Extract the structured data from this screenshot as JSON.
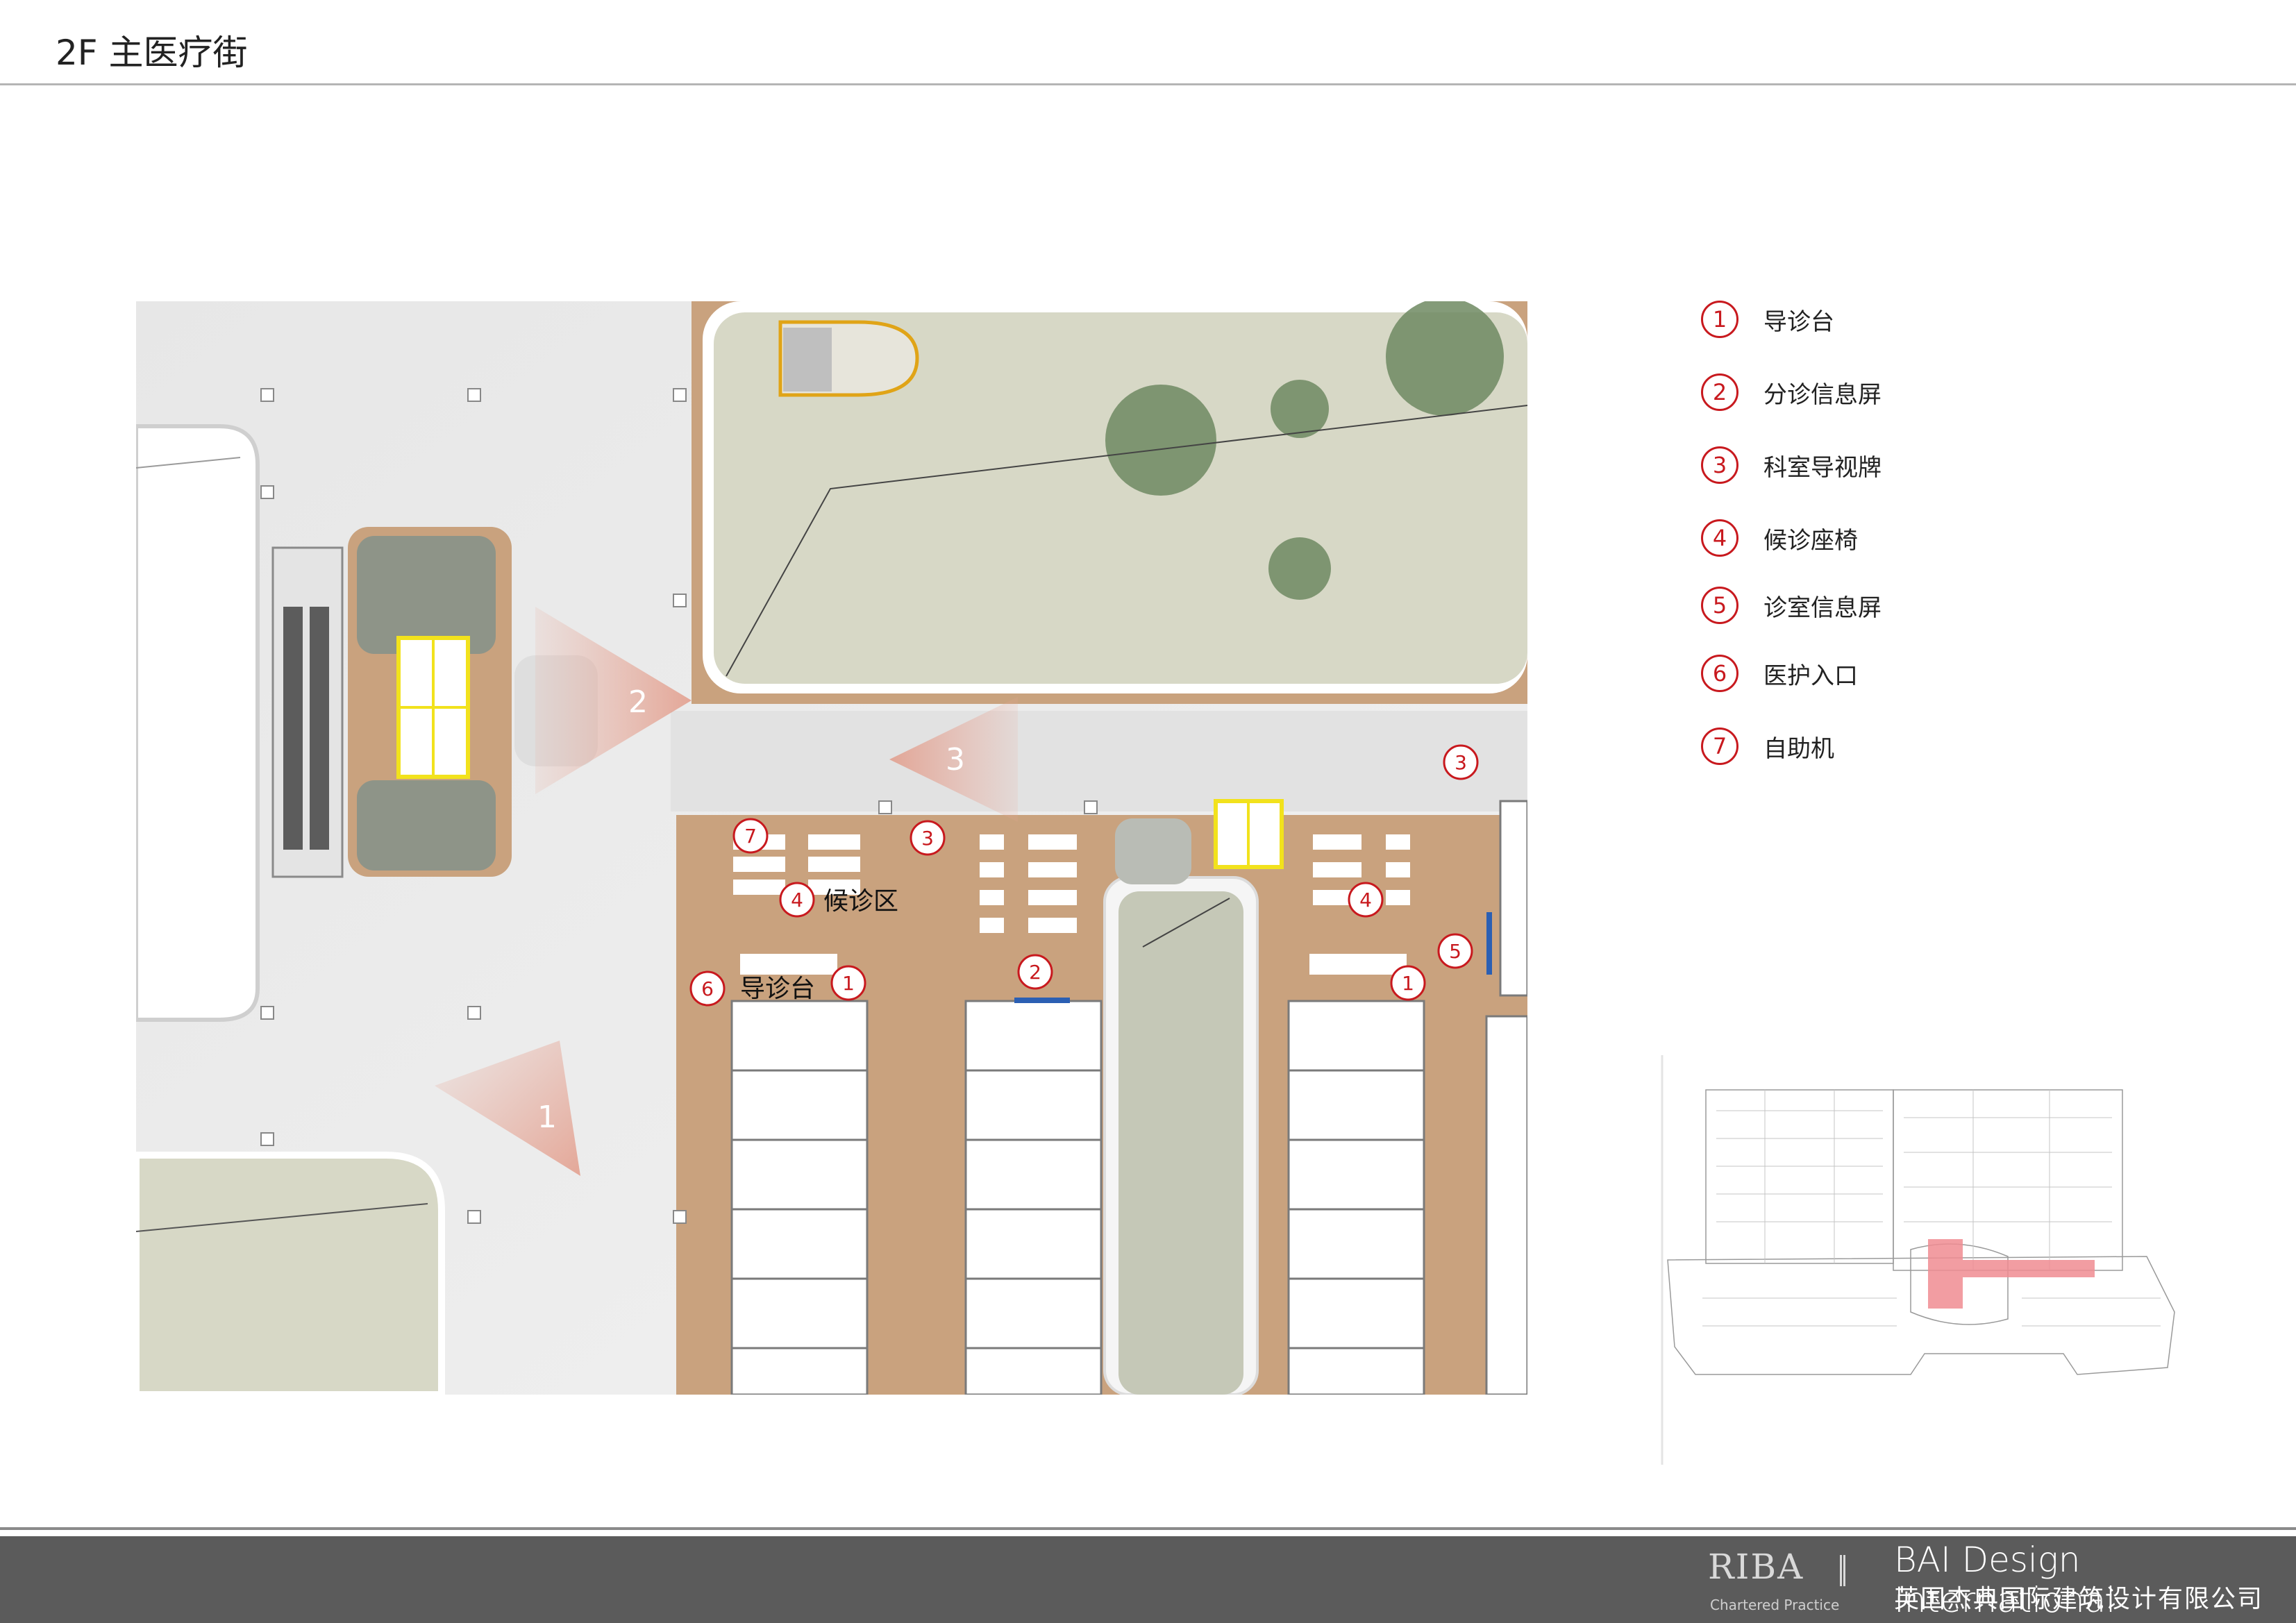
{
  "header": {
    "title": "2F 主医疗街"
  },
  "plan": {
    "area_label_waiting": "候诊区",
    "area_label_guide": "导诊台",
    "flow_arrows": [
      "1",
      "2",
      "3"
    ],
    "markers": [
      "7",
      "3",
      "4",
      "2",
      "6",
      "1",
      "3",
      "4",
      "5",
      "1"
    ]
  },
  "legend": {
    "items": [
      {
        "num": "1",
        "label": "导诊台"
      },
      {
        "num": "2",
        "label": "分诊信息屏"
      },
      {
        "num": "3",
        "label": "科室导视牌"
      },
      {
        "num": "4",
        "label": "候诊座椅"
      },
      {
        "num": "5",
        "label": "诊室信息屏"
      },
      {
        "num": "6",
        "label": "医护入口"
      },
      {
        "num": "7",
        "label": "自助机"
      }
    ]
  },
  "footer": {
    "riba": "RIBA",
    "chartered": "Chartered Practice",
    "company_en": "BAI Design International",
    "company_cn": "英国杰典国际建筑设计有限公司"
  },
  "colors": {
    "accent_red": "#c8191e",
    "floor_tan": "#c9a27e",
    "courtyard": "#d7d8c6",
    "tree": "#6f8a62",
    "highlight_yellow": "#f2e21c",
    "footer_gray": "#5b5b5b"
  }
}
